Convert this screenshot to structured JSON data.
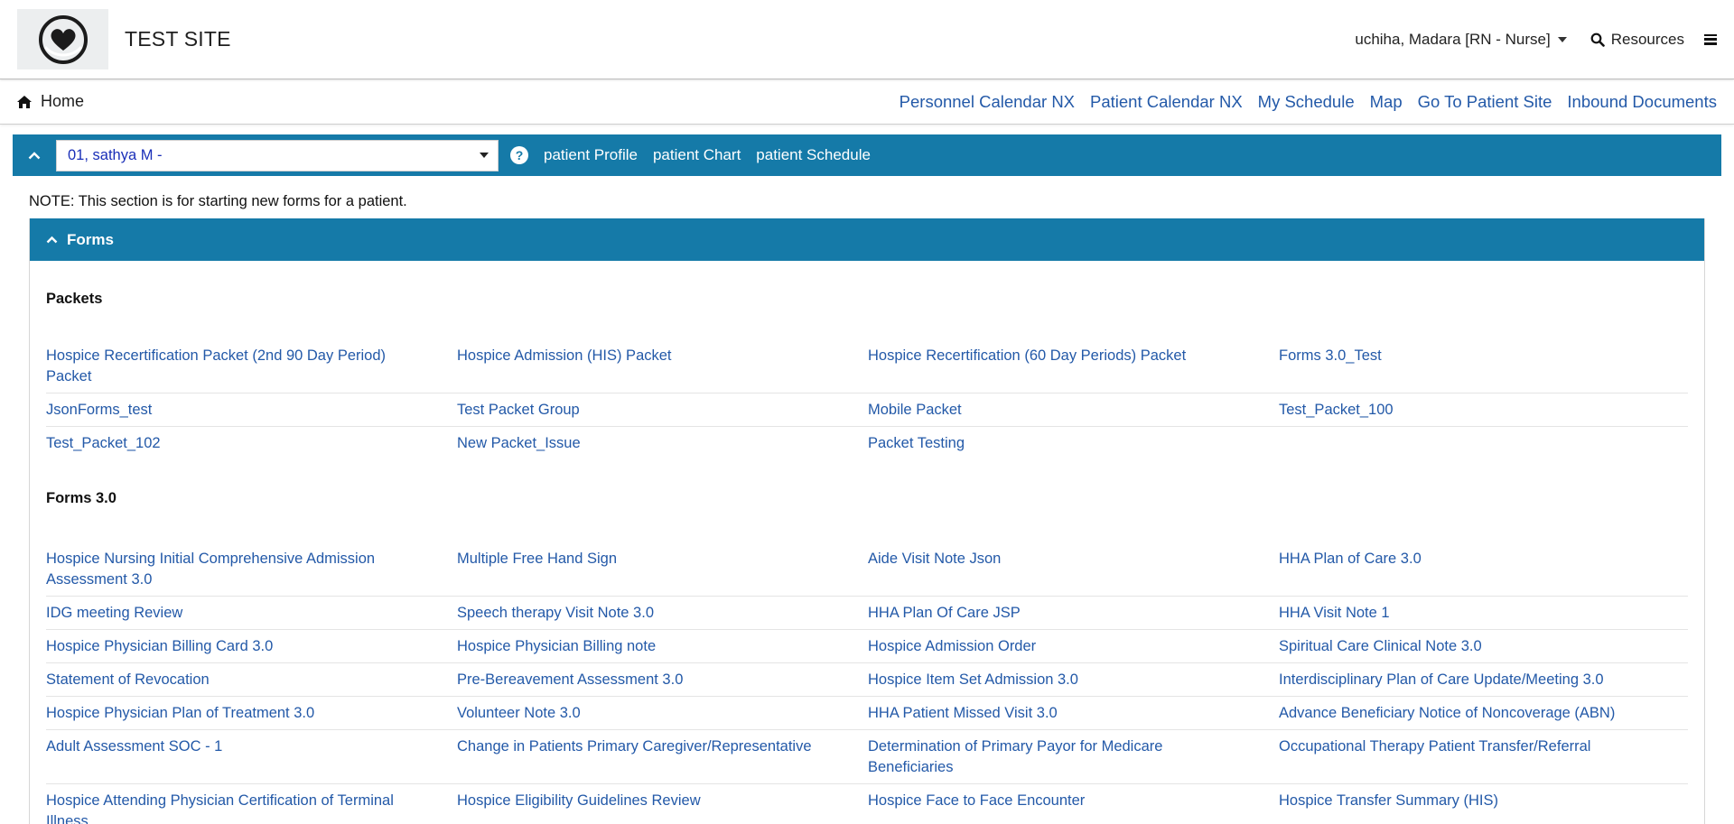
{
  "header": {
    "site_title": "TEST SITE",
    "user": "uchiha, Madara [RN - Nurse]",
    "resources": "Resources"
  },
  "nav": {
    "home": "Home",
    "links": [
      "Personnel Calendar NX",
      "Patient Calendar NX",
      "My Schedule",
      "Map",
      "Go To Patient Site",
      "Inbound Documents"
    ]
  },
  "patient_bar": {
    "selected_patient": "01, sathya M -",
    "links": [
      "patient Profile",
      "patient Chart",
      "patient Schedule"
    ]
  },
  "note": "NOTE: This section is for starting new forms for a patient.",
  "forms_panel": {
    "title": "Forms",
    "packets_title": "Packets",
    "packets": [
      [
        "Hospice Recertification Packet (2nd 90 Day Period) Packet",
        "Hospice Admission (HIS) Packet",
        "Hospice Recertification (60 Day Periods) Packet",
        "Forms 3.0_Test"
      ],
      [
        "JsonForms_test",
        "Test Packet Group",
        "Mobile Packet",
        "Test_Packet_100"
      ],
      [
        "Test_Packet_102",
        "New Packet_Issue",
        "Packet Testing",
        ""
      ]
    ],
    "forms30_title": "Forms 3.0",
    "forms30": [
      [
        "Hospice Nursing Initial Comprehensive Admission Assessment 3.0",
        "Multiple Free Hand Sign",
        "Aide Visit Note Json",
        "HHA Plan of Care 3.0"
      ],
      [
        "IDG meeting Review",
        "Speech therapy Visit Note 3.0",
        "HHA Plan Of Care JSP",
        "HHA Visit Note 1"
      ],
      [
        "Hospice Physician Billing Card 3.0",
        "Hospice Physician Billing note",
        "Hospice Admission Order",
        "Spiritual Care Clinical Note 3.0"
      ],
      [
        "Statement of Revocation",
        "Pre-Bereavement Assessment 3.0",
        "Hospice Item Set Admission 3.0",
        "Interdisciplinary Plan of Care Update/Meeting 3.0"
      ],
      [
        "Hospice Physician Plan of Treatment 3.0",
        "Volunteer Note 3.0",
        "HHA Patient Missed Visit 3.0",
        "Advance Beneficiary Notice of Noncoverage (ABN)"
      ],
      [
        "Adult Assessment SOC - 1",
        "Change in Patients Primary Caregiver/Representative",
        "Determination of Primary Payor for Medicare Beneficiaries",
        "Occupational Therapy Patient Transfer/Referral"
      ],
      [
        "Hospice Attending Physician Certification of Terminal Illness",
        "Hospice Eligibility Guidelines Review",
        "Hospice Face to Face Encounter",
        "Hospice Transfer Summary (HIS)"
      ]
    ]
  },
  "colors": {
    "accent": "#157aa8",
    "link": "#2359a8",
    "patient_text": "#1a2fb8"
  }
}
